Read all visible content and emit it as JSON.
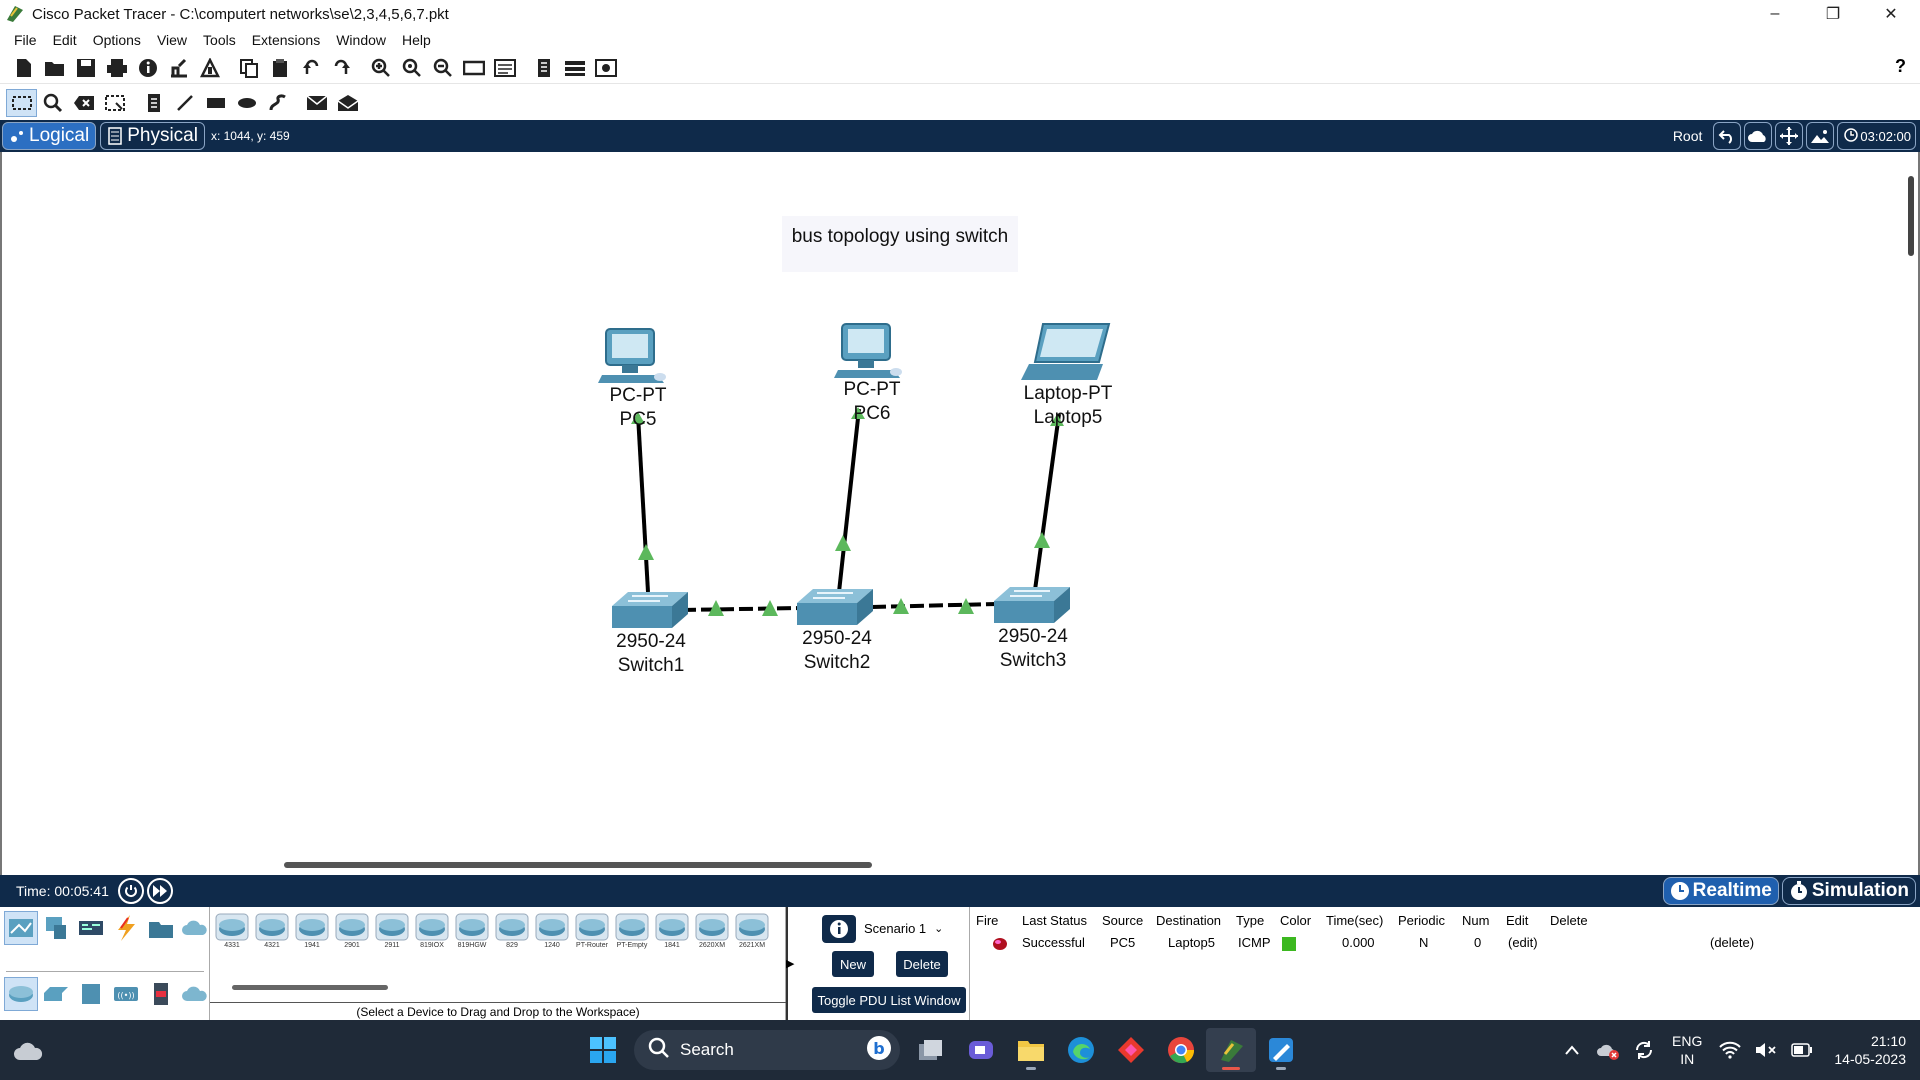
{
  "window": {
    "title": "Cisco Packet Tracer - C:\\computert networks\\se\\2,3,4,5,6,7.pkt"
  },
  "menu": [
    "File",
    "Edit",
    "Options",
    "View",
    "Tools",
    "Extensions",
    "Window",
    "Help"
  ],
  "toolbar1_icons": [
    "new-icon",
    "open-icon",
    "save-icon",
    "print-icon",
    "info-icon",
    "wizard-icon",
    "network-info-icon",
    "copy-icon",
    "paste-icon",
    "undo-icon",
    "redo-icon",
    "zoom-in-icon",
    "zoom-reset-icon",
    "zoom-out-icon",
    "drawing-palette-icon",
    "custom-device-icon",
    "viewport-icon",
    "pdu-icon",
    "cluster-icon"
  ],
  "toolbar2_icons": [
    "select-icon",
    "inspect-icon",
    "delete-icon",
    "resize-icon",
    "note-icon",
    "line-icon",
    "rectangle-icon",
    "ellipse-icon",
    "freeform-icon",
    "add-simple-pdu-icon",
    "add-complex-pdu-icon"
  ],
  "help_label": "?",
  "nav": {
    "logical_label": "Logical",
    "physical_label": "Physical",
    "coords": "x: 1044, y: 459",
    "root_label": "Root",
    "clock": "03:02:00"
  },
  "workspace": {
    "note": "bus topology using switch",
    "devices": [
      {
        "model": "PC-PT",
        "name": "PC5"
      },
      {
        "model": "PC-PT",
        "name": "PC6"
      },
      {
        "model": "Laptop-PT",
        "name": "Laptop5"
      },
      {
        "model": "2950-24",
        "name": "Switch1"
      },
      {
        "model": "2950-24",
        "name": "Switch2"
      },
      {
        "model": "2950-24",
        "name": "Switch3"
      }
    ],
    "link_color": "#000000",
    "link_status_color": "#5cb85c"
  },
  "sim": {
    "time_label": "Time: 00:05:41",
    "realtime_label": "Realtime",
    "simulation_label": "Simulation"
  },
  "devices_palette": [
    "4331",
    "4321",
    "1941",
    "2901",
    "2911",
    "819IOX",
    "819HGW",
    "829",
    "1240",
    "PT-Router",
    "PT-Empty",
    "1841",
    "2620XM",
    "2621XM"
  ],
  "select_hint": "(Select a Device to Drag and Drop to the Workspace)",
  "pdu": {
    "scenario": "Scenario 1",
    "new_label": "New",
    "delete_label": "Delete",
    "toggle_label": "Toggle PDU List Window",
    "headers": [
      "Fire",
      "Last Status",
      "Source",
      "Destination",
      "Type",
      "Color",
      "Time(sec)",
      "Periodic",
      "Num",
      "Edit",
      "Delete"
    ],
    "row": {
      "status": "Successful",
      "source": "PC5",
      "destination": "Laptop5",
      "type": "ICMP",
      "color": "#3cb820",
      "time": "0.000",
      "periodic": "N",
      "num": "0",
      "edit": "(edit)",
      "delete": "(delete)"
    }
  },
  "taskbar": {
    "search_placeholder": "Search",
    "lang": "ENG",
    "region": "IN",
    "time": "21:10",
    "date": "14-05-2023"
  },
  "colors": {
    "navy": "#0f2a4a",
    "accent": "#2c6fc2",
    "taskbar": "#1f2a38"
  }
}
